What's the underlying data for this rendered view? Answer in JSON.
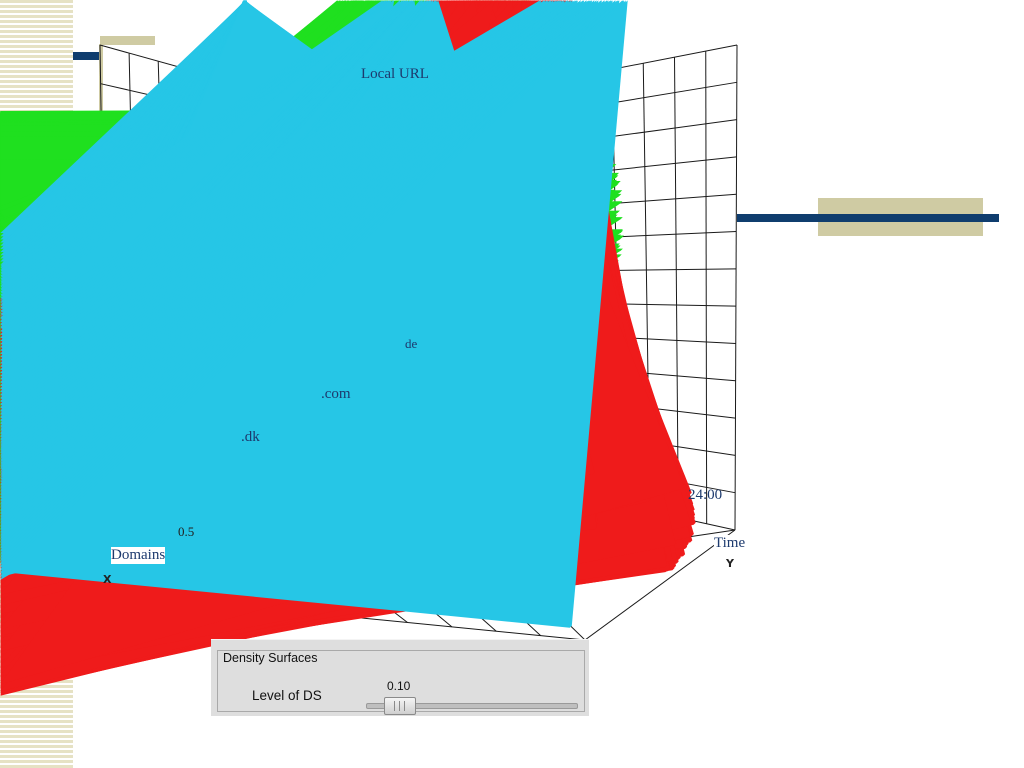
{
  "colors": {
    "stripe": "#e6e2c4",
    "deco_navy": "#0f3d6e",
    "deco_khaki": "#cfcba3",
    "grid": "#1a1a1a",
    "surface_green": "#1fe01f",
    "surface_red": "#ef1b1b",
    "cluster_cyan": "#26c6e6",
    "axis_blue": "#1a1ad8"
  },
  "scene": {
    "labels": {
      "local_url": "Local URL",
      "domains": "Domains",
      "time": "Time",
      "time_max": "24:00",
      "dk": ".dk",
      "com": ".com",
      "tick_05": "0.5",
      "de": "de"
    },
    "axis_letters": {
      "x": "X",
      "y": "Y"
    }
  },
  "panel": {
    "group_title": "Density Surfaces",
    "slider_label": "Level of DS",
    "slider_value_text": "0.10",
    "slider_level": 0.1
  }
}
